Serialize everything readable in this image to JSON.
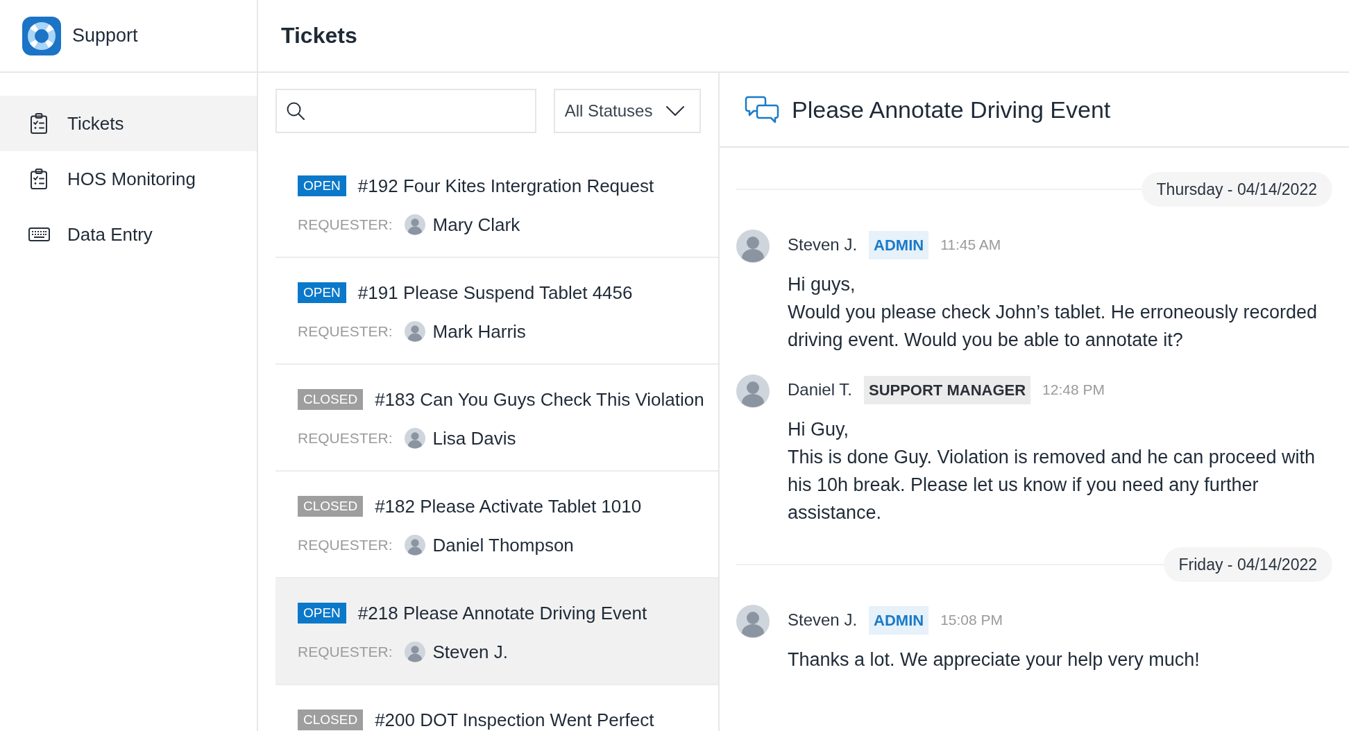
{
  "sidebar": {
    "brand": "Support",
    "items": [
      {
        "label": "Tickets",
        "selected": true
      },
      {
        "label": "HOS Monitoring",
        "selected": false
      },
      {
        "label": "Data Entry",
        "selected": false
      }
    ]
  },
  "header": {
    "title": "Tickets"
  },
  "ticket_list": {
    "status_filter": {
      "value": "All Statuses"
    },
    "tickets": [
      {
        "status": "OPEN",
        "color": "#0b78c9",
        "title": "#192 Four Kites Intergration Request",
        "requester_label": "REQUESTER:",
        "requester": "Mary Clark",
        "selected": false
      },
      {
        "status": "OPEN",
        "color": "#0b78c9",
        "title": "#191 Please Suspend Tablet 4456",
        "requester_label": "REQUESTER:",
        "requester": "Mark Harris",
        "selected": false
      },
      {
        "status": "CLOSED",
        "color": "#9e9e9e",
        "title": "#183 Can You Guys Check This Violation",
        "requester_label": "REQUESTER:",
        "requester": "Lisa Davis",
        "selected": false
      },
      {
        "status": "CLOSED",
        "color": "#9e9e9e",
        "title": "#182 Please Activate Tablet 1010",
        "requester_label": "REQUESTER:",
        "requester": "Daniel Thompson",
        "selected": false
      },
      {
        "status": "OPEN",
        "color": "#0b78c9",
        "title": "#218 Please Annotate Driving Event",
        "requester_label": "REQUESTER:",
        "requester": "Steven J.",
        "selected": true
      },
      {
        "status": "CLOSED",
        "color": "#9e9e9e",
        "title": "#200 DOT Inspection Went Perfect",
        "selected": false
      }
    ]
  },
  "detail": {
    "title": "Please Annotate Driving Event",
    "thread": [
      {
        "kind": "date",
        "label": "Thursday - 04/14/2022"
      },
      {
        "kind": "message",
        "author": "Steven J.",
        "role": {
          "label": "ADMIN",
          "kind": "admin"
        },
        "time": "11:45 AM",
        "text": "Hi guys,\nWould you please check John’s tablet. He erroneously recorded driving event. Would you be able to annotate it?"
      },
      {
        "kind": "message",
        "author": "Daniel T.",
        "role": {
          "label": "SUPPORT MANAGER",
          "kind": "manager"
        },
        "time": "12:48 PM",
        "text": "Hi Guy,\nThis is done Guy. Violation is removed and he can proceed with his 10h break. Please let us know if you need any further assistance."
      },
      {
        "kind": "date",
        "label": "Friday - 04/14/2022"
      },
      {
        "kind": "message",
        "author": "Steven J.",
        "role": {
          "label": "ADMIN",
          "kind": "admin"
        },
        "time": "15:08 PM",
        "text": "Thanks a lot. We appreciate your help very much!"
      }
    ]
  }
}
